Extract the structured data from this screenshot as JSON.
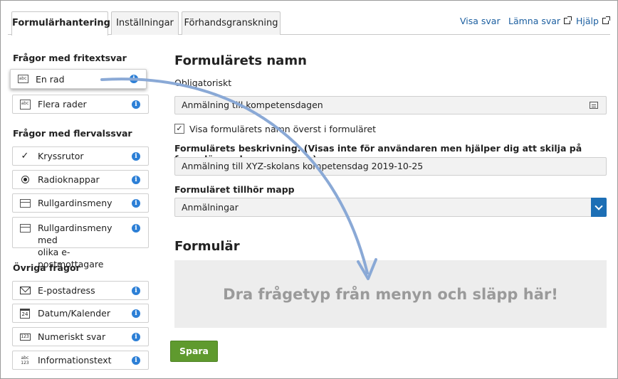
{
  "tabs": [
    {
      "label": "Formulärhantering",
      "active": true
    },
    {
      "label": "Inställningar",
      "active": false
    },
    {
      "label": "Förhandsgranskning",
      "active": false
    }
  ],
  "top_links": {
    "view_answers": "Visa svar",
    "submit_answer": "Lämna svar",
    "help": "Hjälp"
  },
  "sidebar": {
    "free_text_title": "Frågor med fritextsvar",
    "free_text_items": [
      "En rad",
      "Flera rader"
    ],
    "multi_choice_title": "Frågor med flervalssvar",
    "multi_choice_items": [
      "Kryssrutor",
      "Radioknappar",
      "Rullgardinsmeny",
      "Rullgardinsmeny med",
      "olika e-postmottagare"
    ],
    "other_title": "Övriga frågor",
    "other_items": [
      "E-postadress",
      "Datum/Kalender",
      "Numeriskt svar",
      "Informationstext"
    ],
    "info_glyph": "i",
    "icon_labels": {
      "abc": "abc",
      "cal": "24",
      "num": "123",
      "txt1": "abc",
      "txt2": "123"
    }
  },
  "main": {
    "form_name_heading": "Formulärets namn",
    "required_label": "Obligatoriskt",
    "form_name_value": "Anmälning till kompetensdagen",
    "show_name_checkbox_label": "Visa formulärets namn överst i formuläret",
    "show_name_checked": true,
    "check_glyph": "✓",
    "description_label": "Formulärets beskrivning. (Visas inte för användaren men hjälper dig att skilja på formulär med samma namn)",
    "description_value": "Anmälning till XYZ-skolans kompetensdag 2019-10-25",
    "folder_label": "Formuläret tillhör mapp",
    "folder_value": "Anmälningar",
    "form_heading": "Formulär",
    "dropzone_text": "Dra frågetyp från menyn och släpp här!",
    "save_label": "Spara"
  },
  "colors": {
    "link": "#1c5fa0",
    "info": "#2c7fd6",
    "save": "#5f9a2e",
    "select_button": "#1d6fb5",
    "arrow": "#8aa9d6"
  }
}
